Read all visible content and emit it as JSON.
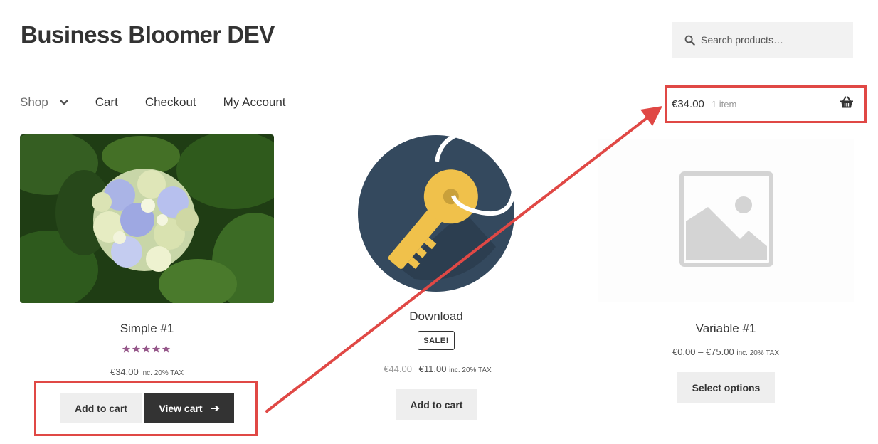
{
  "site": {
    "title": "Business Bloomer DEV"
  },
  "search": {
    "placeholder": "Search products…",
    "icon": "search-icon"
  },
  "nav": {
    "items": [
      {
        "label": "Shop",
        "has_dropdown": true
      },
      {
        "label": "Cart"
      },
      {
        "label": "Checkout"
      },
      {
        "label": "My Account"
      }
    ]
  },
  "cart": {
    "total": "€34.00",
    "count": "1 item",
    "icon": "basket-icon"
  },
  "products": [
    {
      "title": "Simple #1",
      "rating": 5,
      "price": "€34.00",
      "tax_note": "inc. 20% TAX",
      "add_label": "Add to cart",
      "view_label": "View cart"
    },
    {
      "title": "Download",
      "badge": "SALE!",
      "old_price": "€44.00",
      "price": "€11.00",
      "tax_note": "inc. 20% TAX",
      "add_label": "Add to cart"
    },
    {
      "title": "Variable #1",
      "price": "€0.00 – €75.00",
      "tax_note": "inc. 20% TAX",
      "options_label": "Select options"
    }
  ],
  "colors": {
    "annotation": "#e04845",
    "star": "#96588a",
    "dark_button": "#333333",
    "light_button": "#eeeeee",
    "key_circle": "#34495e",
    "key_gold": "#f0c14b"
  }
}
